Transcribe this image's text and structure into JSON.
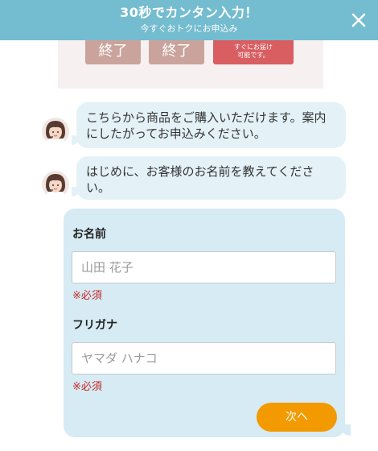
{
  "header": {
    "title": "30秒でカンタン入力！",
    "subtitle": "今すぐおトクにお申込み",
    "close_icon": "close-icon",
    "background": "#74bccf"
  },
  "product_panel": {
    "end_label_1": "終了",
    "end_label_2": "終了",
    "ship_label_line1": "すぐにお届け",
    "ship_label_line2": "可能です。"
  },
  "chat": {
    "messages": [
      {
        "text": "こちらから商品をご購入いただけます。案内にしたがってお申込みください。",
        "avatar": "operator-avatar"
      },
      {
        "text": "はじめに、お客様のお名前を教えてください。",
        "avatar": "operator-avatar"
      }
    ]
  },
  "form": {
    "name_label": "お名前",
    "name_placeholder": "山田 花子",
    "name_value": "",
    "name_required": "※必須",
    "kana_label": "フリガナ",
    "kana_placeholder": "ヤマダ ハナコ",
    "kana_value": "",
    "kana_required": "※必須",
    "next_label": "次へ"
  },
  "colors": {
    "accent": "#f39a00",
    "bubble": "#e4f2f8",
    "card": "#d6ebf3",
    "required": "#c62828"
  }
}
